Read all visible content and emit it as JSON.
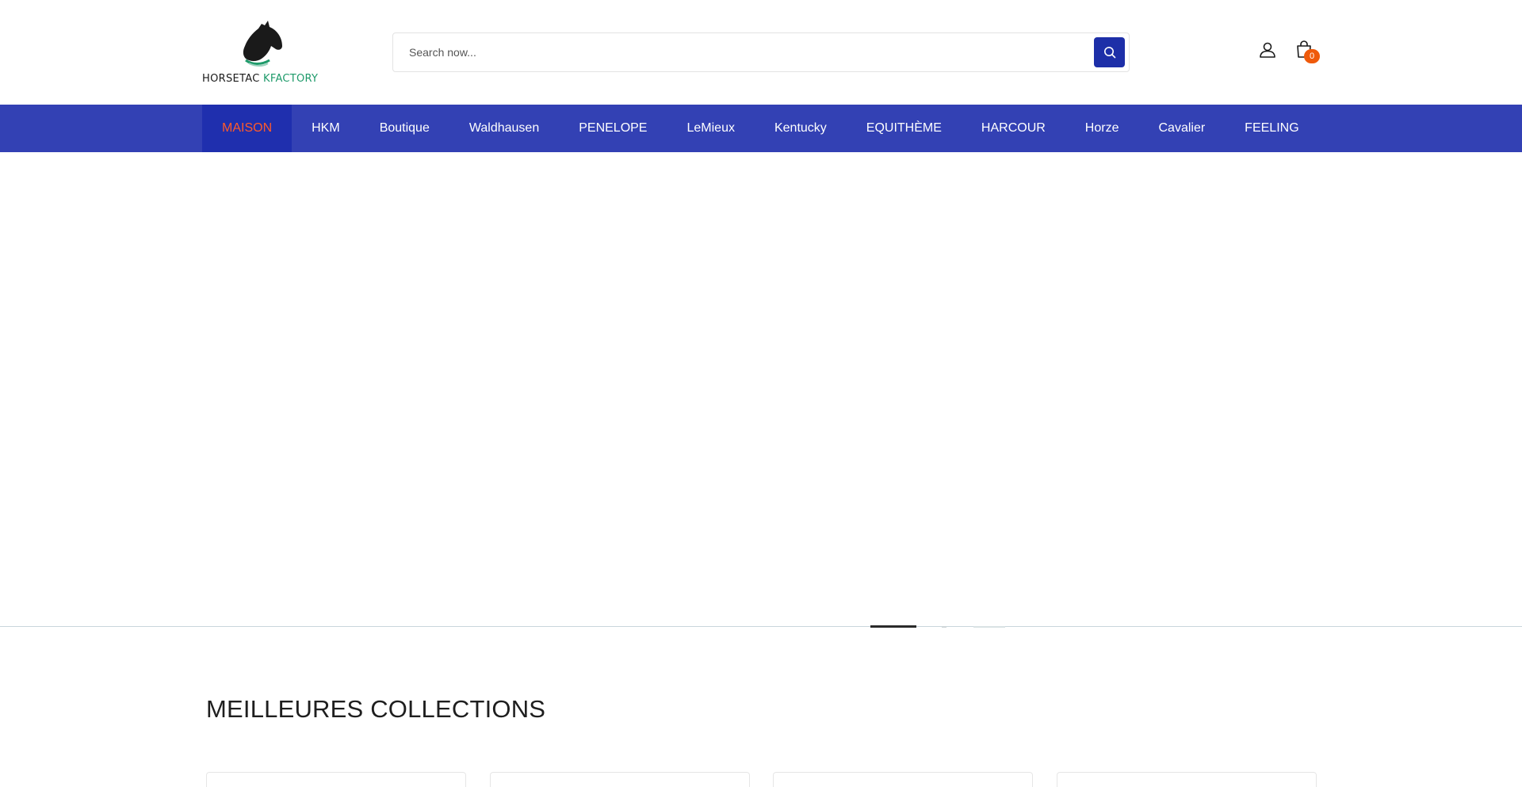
{
  "header": {
    "logo": {
      "word1": "HORSETAC",
      "word2": "KFACTORY"
    },
    "search": {
      "placeholder": "Search now..."
    },
    "cart": {
      "count": "0"
    }
  },
  "nav": {
    "items": [
      {
        "label": "MAISON"
      },
      {
        "label": "HKM"
      },
      {
        "label": "Boutique"
      },
      {
        "label": "Waldhausen"
      },
      {
        "label": "PENELOPE"
      },
      {
        "label": "LeMieux"
      },
      {
        "label": "Kentucky"
      },
      {
        "label": "EQUITHÈME"
      },
      {
        "label": "HARCOUR"
      },
      {
        "label": "Horze"
      },
      {
        "label": "Cavalier"
      },
      {
        "label": "FEELING"
      }
    ]
  },
  "collections": {
    "title": "MEILLEURES COLLECTIONS"
  },
  "colors": {
    "nav_bg": "#3341b4",
    "nav_active_bg": "#1f2fae",
    "nav_active_text": "#ff5a2a",
    "search_button": "#1d2fa8",
    "cart_badge": "#ef5a0b",
    "logo_accent": "#1e9a6a"
  },
  "icons": {
    "logo": "horse-head-icon",
    "search": "search-icon",
    "account": "user-icon",
    "cart": "shopping-bag-icon"
  }
}
